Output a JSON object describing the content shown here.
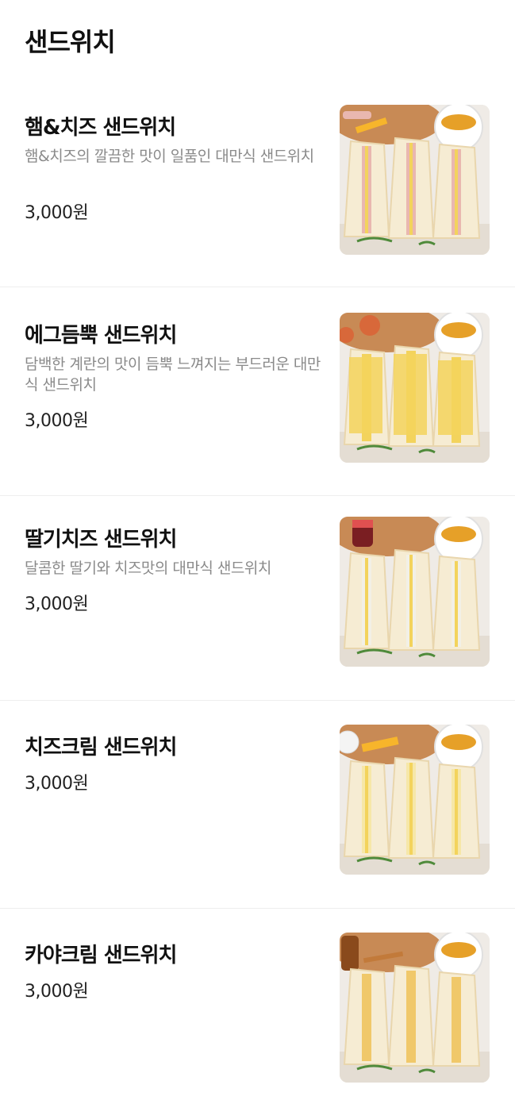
{
  "section_title": "샌드위치",
  "items": [
    {
      "name": "햄&치즈 샌드위치",
      "description": "햄&치즈의 깔끔한 맛이 일품인 대만식 샌드위치",
      "price": "3,000원",
      "image_icon": "ham-cheese-sandwich-image",
      "filling": "ham"
    },
    {
      "name": "에그듬뿍 샌드위치",
      "description": "담백한 계란의 맛이 듬뿍 느껴지는 부드러운 대만식 샌드위치",
      "price": "3,000원",
      "image_icon": "egg-sandwich-image",
      "filling": "egg"
    },
    {
      "name": "딸기치즈 샌드위치",
      "description": "달콤한 딸기와 치즈맛의 대만식 샌드위치",
      "price": "3,000원",
      "image_icon": "strawberry-cheese-sandwich-image",
      "filling": "strawberry"
    },
    {
      "name": "치즈크림 샌드위치",
      "description": "",
      "price": "3,000원",
      "image_icon": "cheese-cream-sandwich-image",
      "filling": "cheese"
    },
    {
      "name": "카야크림 샌드위치",
      "description": "",
      "price": "3,000원",
      "image_icon": "kaya-cream-sandwich-image",
      "filling": "kaya"
    }
  ],
  "colors": {
    "bread": "#f6ecd3",
    "crust": "#e9d6ad",
    "egg": "#f3d35c",
    "ham": "#e9b7b0",
    "board": "#c88a55",
    "tea": "#e6a028",
    "cup": "#ffffff",
    "herb": "#4f8a3a",
    "background": "#efebe6"
  }
}
